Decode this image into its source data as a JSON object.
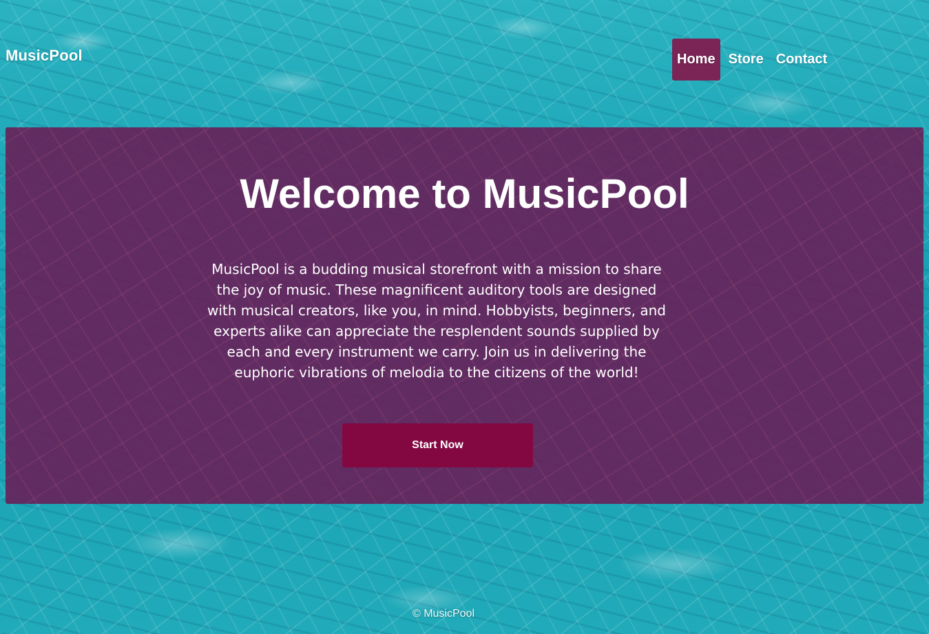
{
  "site": {
    "brand": "MusicPool"
  },
  "nav": {
    "items": [
      {
        "label": "Home",
        "active": true
      },
      {
        "label": "Store",
        "active": false
      },
      {
        "label": "Contact",
        "active": false
      }
    ]
  },
  "hero": {
    "title": "Welcome to MusicPool",
    "description": "MusicPool is a budding musical storefront with a mission to share the joy of music. These magnificent auditory tools are designed with musical creators, like you, in mind. Hobbyists, beginners, and experts alike can appreciate the resplendent sounds supplied by each and every instrument we carry. Join us in delivering the euphoric vibrations of melodia to the citizens of the world!",
    "button_label": "Start Now"
  },
  "footer": {
    "copyright": "© MusicPool"
  },
  "colors": {
    "water": "#1fa9b8",
    "hero_overlay": "#681f58",
    "nav_active": "#7a2556",
    "button": "#830842",
    "text": "#ffffff"
  }
}
